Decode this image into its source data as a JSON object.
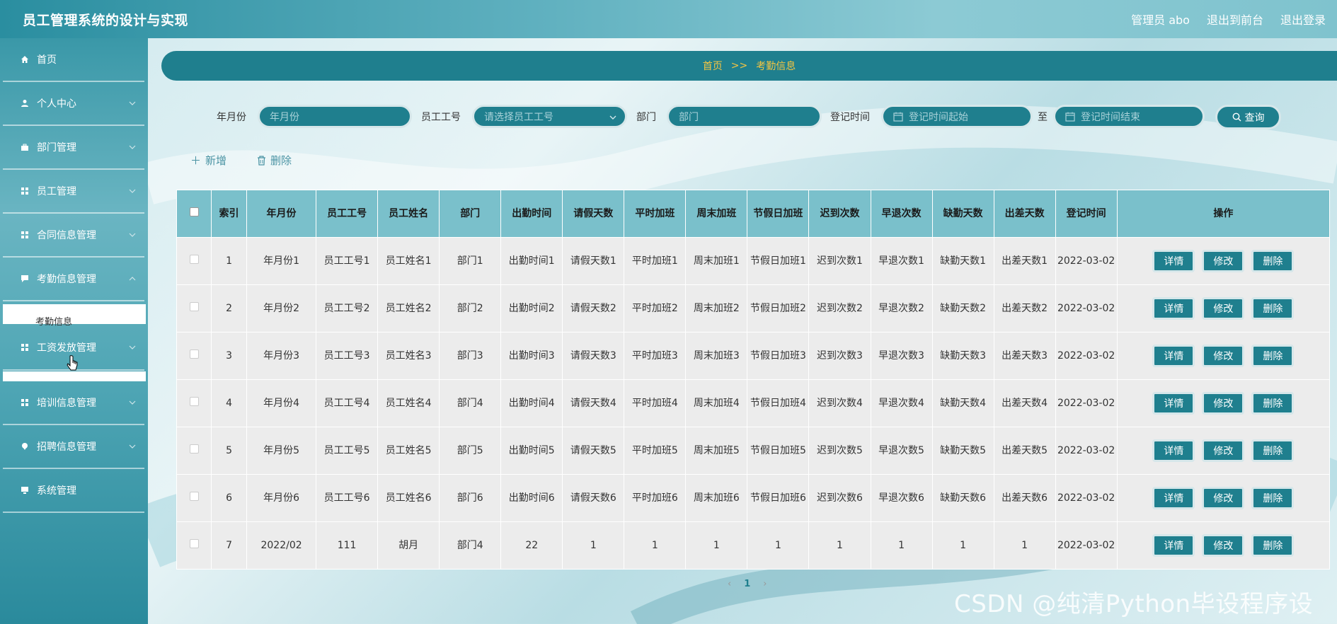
{
  "header": {
    "title": "员工管理系统的设计与实现",
    "user_label": "管理员 abo",
    "back_front": "退出到前台",
    "logout": "退出登录"
  },
  "sidebar": {
    "items": [
      {
        "label": "首页",
        "icon": "home-icon"
      },
      {
        "label": "个人中心",
        "icon": "user-icon"
      },
      {
        "label": "部门管理",
        "icon": "briefcase-icon"
      },
      {
        "label": "员工管理",
        "icon": "grid-icon"
      },
      {
        "label": "合同信息管理",
        "icon": "grid-icon"
      },
      {
        "label": "考勤信息管理",
        "icon": "chat-icon"
      },
      {
        "label": "工资发放管理",
        "icon": "grid-icon"
      },
      {
        "label": "培训信息管理",
        "icon": "grid-icon"
      },
      {
        "label": "招聘信息管理",
        "icon": "pin-icon"
      },
      {
        "label": "系统管理",
        "icon": "monitor-icon"
      }
    ],
    "submenu_attendance": "考勤信息"
  },
  "breadcrumb": {
    "home": "首页",
    "separator": ">>",
    "current": "考勤信息"
  },
  "filters": {
    "month_label": "年月份",
    "month_placeholder": "年月份",
    "empno_label": "员工工号",
    "empno_placeholder": "请选择员工工号",
    "dept_label": "部门",
    "dept_placeholder": "部门",
    "regtime_label": "登记时间",
    "regtime_start_placeholder": "登记时间起始",
    "to_label": "至",
    "regtime_end_placeholder": "登记时间结束",
    "query_label": "查询"
  },
  "actions": {
    "add": "新增",
    "delete": "删除"
  },
  "table": {
    "columns": [
      "索引",
      "年月份",
      "员工工号",
      "员工姓名",
      "部门",
      "出勤时间",
      "请假天数",
      "平时加班",
      "周末加班",
      "节假日加班",
      "迟到次数",
      "早退次数",
      "缺勤天数",
      "出差天数",
      "登记时间",
      "操作"
    ],
    "rows": [
      [
        "1",
        "年月份1",
        "员工工号1",
        "员工姓名1",
        "部门1",
        "出勤时间1",
        "请假天数1",
        "平时加班1",
        "周末加班1",
        "节假日加班1",
        "迟到次数1",
        "早退次数1",
        "缺勤天数1",
        "出差天数1",
        "2022-03-02"
      ],
      [
        "2",
        "年月份2",
        "员工工号2",
        "员工姓名2",
        "部门2",
        "出勤时间2",
        "请假天数2",
        "平时加班2",
        "周末加班2",
        "节假日加班2",
        "迟到次数2",
        "早退次数2",
        "缺勤天数2",
        "出差天数2",
        "2022-03-02"
      ],
      [
        "3",
        "年月份3",
        "员工工号3",
        "员工姓名3",
        "部门3",
        "出勤时间3",
        "请假天数3",
        "平时加班3",
        "周末加班3",
        "节假日加班3",
        "迟到次数3",
        "早退次数3",
        "缺勤天数3",
        "出差天数3",
        "2022-03-02"
      ],
      [
        "4",
        "年月份4",
        "员工工号4",
        "员工姓名4",
        "部门4",
        "出勤时间4",
        "请假天数4",
        "平时加班4",
        "周末加班4",
        "节假日加班4",
        "迟到次数4",
        "早退次数4",
        "缺勤天数4",
        "出差天数4",
        "2022-03-02"
      ],
      [
        "5",
        "年月份5",
        "员工工号5",
        "员工姓名5",
        "部门5",
        "出勤时间5",
        "请假天数5",
        "平时加班5",
        "周末加班5",
        "节假日加班5",
        "迟到次数5",
        "早退次数5",
        "缺勤天数5",
        "出差天数5",
        "2022-03-02"
      ],
      [
        "6",
        "年月份6",
        "员工工号6",
        "员工姓名6",
        "部门6",
        "出勤时间6",
        "请假天数6",
        "平时加班6",
        "周末加班6",
        "节假日加班6",
        "迟到次数6",
        "早退次数6",
        "缺勤天数6",
        "出差天数6",
        "2022-03-02"
      ],
      [
        "7",
        "2022/02",
        "111",
        "胡月",
        "部门4",
        "22",
        "1",
        "1",
        "1",
        "1",
        "1",
        "1",
        "1",
        "1",
        "2022-03-02"
      ]
    ],
    "row_actions": [
      "详情",
      "修改",
      "删除"
    ]
  },
  "pagination": {
    "prev": "‹",
    "current": "1",
    "next": "›"
  },
  "watermark": "CSDN @纯清Python毕设程序设计",
  "colors": {
    "primary": "#1f7f8e",
    "header_bg": "#7ac0cb",
    "crumb_text": "#f5c542"
  }
}
